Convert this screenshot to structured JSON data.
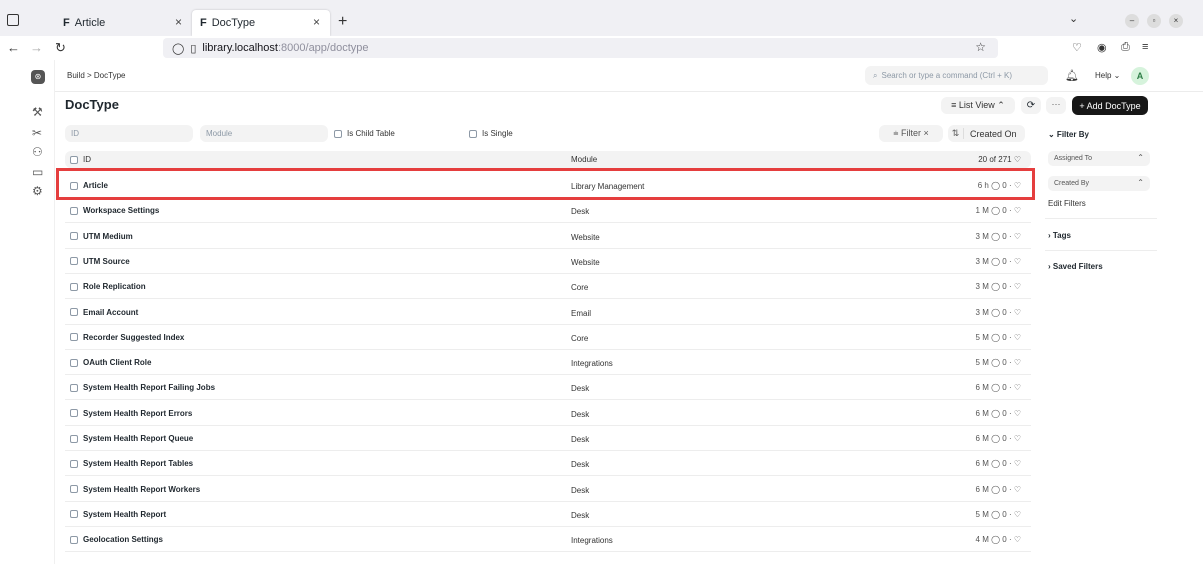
{
  "browser": {
    "tabs": [
      {
        "favicon": "F",
        "label": "Article",
        "close": "×"
      },
      {
        "favicon": "F",
        "label": "DocType",
        "close": "×"
      }
    ],
    "new_tab": "+",
    "url_host": "library.localhost",
    "url_path": ":8000/app/doctype"
  },
  "topbar": {
    "breadcrumb": "Build  >  DocType",
    "search_placeholder": "Search or type a command (Ctrl + K)",
    "help_label": "Help ⌄",
    "avatar_initial": "A"
  },
  "page": {
    "title": "DocType",
    "list_view_label": "≡ List View ⌃",
    "add_button_label": "+ Add DocType",
    "more_label": "···",
    "refresh_label": "⟳"
  },
  "filters": {
    "id_placeholder": "ID",
    "module_placeholder": "Module",
    "is_child_table": "Is Child Table",
    "is_single": "Is Single",
    "filter_label": "⩧ Filter  ×",
    "sort_label": "Created On",
    "sort_icon": "⇅"
  },
  "list_header": {
    "id": "ID",
    "module": "Module",
    "count": "20 of 271  ♡"
  },
  "rows": [
    {
      "name": "Article",
      "module": "Library Management",
      "meta": "6 h   ◯ 0  ·  ♡"
    },
    {
      "name": "Workspace Settings",
      "module": "Desk",
      "meta": "1 M   ◯ 0  ·  ♡"
    },
    {
      "name": "UTM Medium",
      "module": "Website",
      "meta": "3 M   ◯ 0  ·  ♡"
    },
    {
      "name": "UTM Source",
      "module": "Website",
      "meta": "3 M   ◯ 0  ·  ♡"
    },
    {
      "name": "Role Replication",
      "module": "Core",
      "meta": "3 M   ◯ 0  ·  ♡"
    },
    {
      "name": "Email Account",
      "module": "Email",
      "meta": "3 M   ◯ 0  ·  ♡"
    },
    {
      "name": "Recorder Suggested Index",
      "module": "Core",
      "meta": "5 M   ◯ 0  ·  ♡"
    },
    {
      "name": "OAuth Client Role",
      "module": "Integrations",
      "meta": "5 M   ◯ 0  ·  ♡"
    },
    {
      "name": "System Health Report Failing Jobs",
      "module": "Desk",
      "meta": "6 M   ◯ 0  ·  ♡"
    },
    {
      "name": "System Health Report Errors",
      "module": "Desk",
      "meta": "6 M   ◯ 0  ·  ♡"
    },
    {
      "name": "System Health Report Queue",
      "module": "Desk",
      "meta": "6 M   ◯ 0  ·  ♡"
    },
    {
      "name": "System Health Report Tables",
      "module": "Desk",
      "meta": "6 M   ◯ 0  ·  ♡"
    },
    {
      "name": "System Health Report Workers",
      "module": "Desk",
      "meta": "6 M   ◯ 0  ·  ♡"
    },
    {
      "name": "System Health Report",
      "module": "Desk",
      "meta": "5 M   ◯ 0  ·  ♡"
    },
    {
      "name": "Geolocation Settings",
      "module": "Integrations",
      "meta": "4 M   ◯ 0  ·  ♡"
    }
  ],
  "sidebar_right": {
    "filter_by": "⌄ Filter By",
    "assigned_to": "Assigned To",
    "created_by": "Created By",
    "edit_filters": "Edit Filters",
    "tags": "›  Tags",
    "saved_filters": "›  Saved Filters"
  },
  "colors": {
    "highlight": "#e53e3e",
    "primary_button": "#171717"
  }
}
